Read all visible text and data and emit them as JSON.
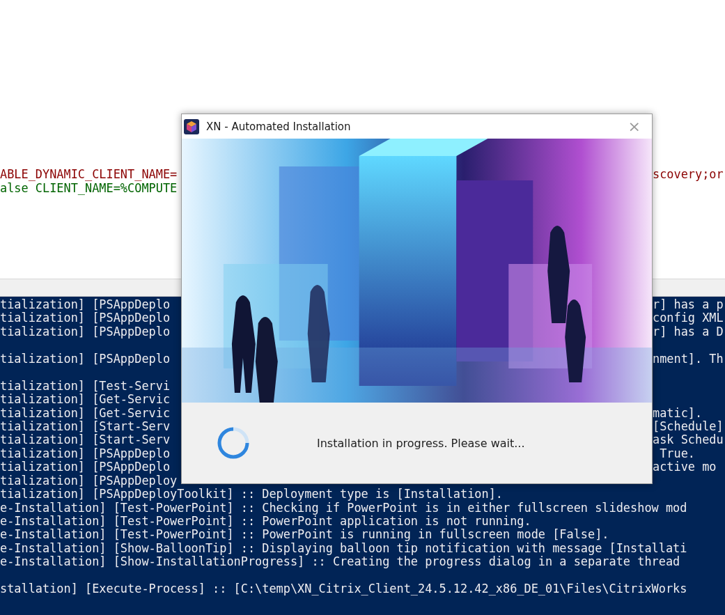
{
  "editor": {
    "lines": [
      {
        "left": "ABLE_DYNAMIC_CLIENT_NAME=",
        "right": "scovery;or",
        "color": "#8b0000"
      },
      {
        "left": "alse CLIENT_NAME=%COMPUTE",
        "color": "#006400"
      }
    ]
  },
  "console": {
    "lines": [
      {
        "kind": "split",
        "left": "tialization] [PSAppDeplo",
        "right": "r] has a p"
      },
      {
        "kind": "split",
        "left": "tialization] [PSAppDeplo",
        "right": "config XML"
      },
      {
        "kind": "split",
        "left": "tialization] [PSAppDeplo",
        "right": "r] has a D"
      },
      {
        "kind": "blank"
      },
      {
        "kind": "split",
        "left": "tialization] [PSAppDeplo",
        "right": "nment]. Th"
      },
      {
        "kind": "blank"
      },
      {
        "kind": "split",
        "left": "tialization] [Test-Servi"
      },
      {
        "kind": "split",
        "left": "tialization] [Get-Servic"
      },
      {
        "kind": "split",
        "left": "tialization] [Get-Servic",
        "right": "matic]."
      },
      {
        "kind": "split",
        "left": "tialization] [Start-Serv",
        "right": "[Schedule]"
      },
      {
        "kind": "split",
        "left": "tialization] [Start-Serv",
        "right": "ask Schedu"
      },
      {
        "kind": "split",
        "left": "tialization] [PSAppDeplo",
        "right": " True."
      },
      {
        "kind": "split",
        "left": "tialization] [PSAppDeplo",
        "right": "active mo"
      },
      {
        "kind": "split",
        "left": "tialization] [PSAppDeploy"
      },
      {
        "kind": "full",
        "text": "tialization] [PSAppDeployToolkit] :: Deployment type is [Installation]."
      },
      {
        "kind": "full",
        "text": "e-Installation] [Test-PowerPoint] :: Checking if PowerPoint is in either fullscreen slideshow mod"
      },
      {
        "kind": "full",
        "text": "e-Installation] [Test-PowerPoint] :: PowerPoint application is not running."
      },
      {
        "kind": "full",
        "text": "e-Installation] [Test-PowerPoint] :: PowerPoint is running in fullscreen mode [False]."
      },
      {
        "kind": "full",
        "text": "e-Installation] [Show-BalloonTip] :: Displaying balloon tip notification with message [Installati"
      },
      {
        "kind": "full",
        "text": "e-Installation] [Show-InstallationProgress] :: Creating the progress dialog in a separate thread"
      },
      {
        "kind": "blank"
      },
      {
        "kind": "full",
        "text": "stallation] [Execute-Process] :: [C:\\temp\\XN_Citrix_Client_24.5.12.42_x86_DE_01\\Files\\CitrixWorks"
      }
    ]
  },
  "dialog": {
    "title": "XN - Automated Installation",
    "close": "×",
    "message": "Installation in progress. Please wait..."
  }
}
